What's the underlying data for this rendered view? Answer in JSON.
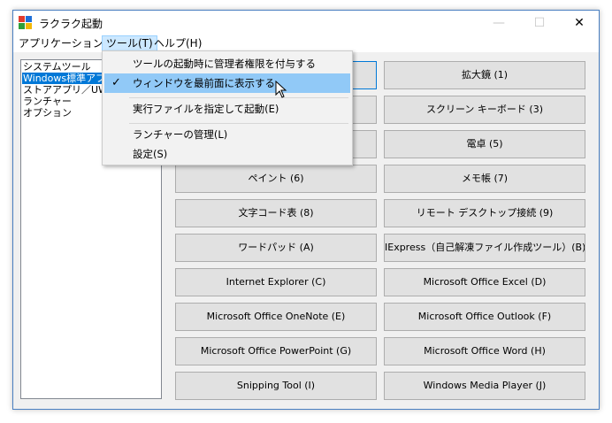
{
  "window": {
    "title": "ラクラク起動",
    "controls": {
      "minimize": "—",
      "maximize": "☐",
      "close": "✕"
    }
  },
  "menubar": [
    {
      "label": "アプリケーション(A)"
    },
    {
      "label": "ツール(T)"
    },
    {
      "label": "ヘルプ(H)"
    }
  ],
  "tree": [
    {
      "label": "システムツール"
    },
    {
      "label": "Windows標準アプリ"
    },
    {
      "label": "ストアアプリ／UWP"
    },
    {
      "label": "ランチャー"
    },
    {
      "label": "オプション"
    }
  ],
  "buttons": [
    {
      "label": ""
    },
    {
      "label": "拡大鏡 (1)"
    },
    {
      "label": ""
    },
    {
      "label": "スクリーン キーボード (3)"
    },
    {
      "label": ""
    },
    {
      "label": "電卓 (5)"
    },
    {
      "label": "ペイント (6)"
    },
    {
      "label": "メモ帳 (7)"
    },
    {
      "label": "文字コード表 (8)"
    },
    {
      "label": "リモート デスクトップ接続 (9)"
    },
    {
      "label": "ワードパッド (A)"
    },
    {
      "label": "IExpress（自己解凍ファイル作成ツール）(B)"
    },
    {
      "label": "Internet Explorer (C)"
    },
    {
      "label": "Microsoft Office Excel (D)"
    },
    {
      "label": "Microsoft Office OneNote (E)"
    },
    {
      "label": "Microsoft Office Outlook (F)"
    },
    {
      "label": "Microsoft Office PowerPoint (G)"
    },
    {
      "label": "Microsoft Office Word (H)"
    },
    {
      "label": "Snipping Tool (I)"
    },
    {
      "label": "Windows Media Player (J)"
    }
  ],
  "dropdown": {
    "items": [
      {
        "label": "ツールの起動時に管理者権限を付与する",
        "checked": false
      },
      {
        "label": "ウィンドウを最前面に表示する",
        "checked": true,
        "check_glyph": "✓"
      },
      {
        "label": "実行ファイルを指定して起動(E)",
        "checked": false
      },
      {
        "label": "ランチャーの管理(L)",
        "checked": false
      },
      {
        "label": "設定(S)",
        "checked": false
      }
    ]
  },
  "colors": {
    "accent": "#0078d7",
    "menu_highlight": "#91c9f7",
    "active_menu": "#cce8ff",
    "button_face": "#e1e1e1"
  },
  "icons": [
    "app-icon",
    "minimize-icon",
    "maximize-icon",
    "close-icon",
    "check-icon",
    "mouse-cursor-icon"
  ]
}
